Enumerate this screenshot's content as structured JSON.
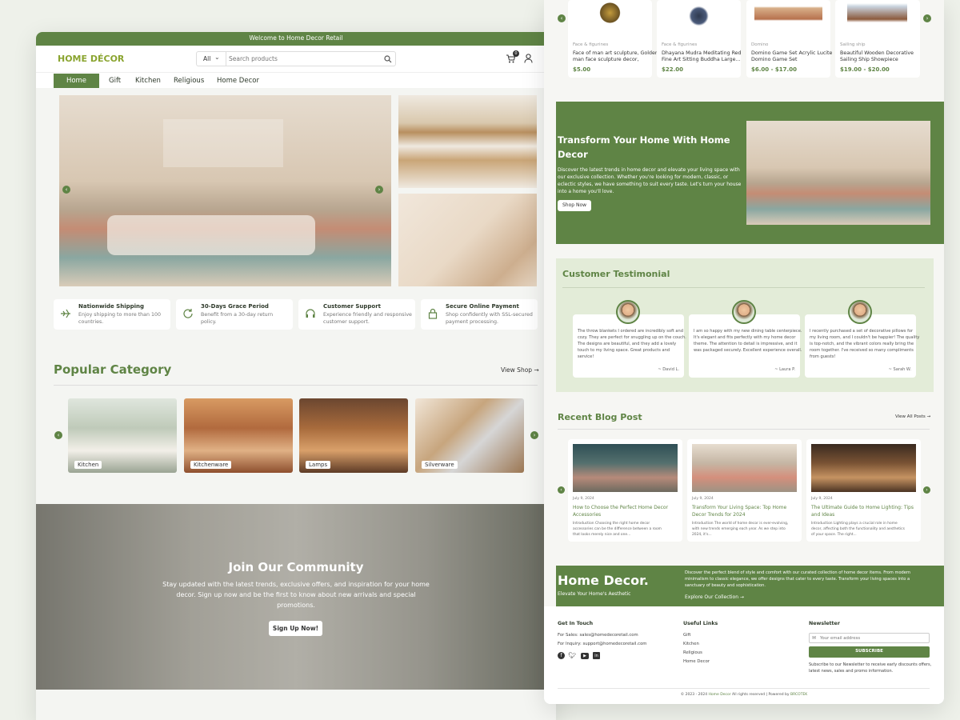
{
  "brand": {
    "logo": "HOME DÉCOR",
    "accent": "#5f8445"
  },
  "topbar": {
    "welcome": "Welcome to Home Decor Retail"
  },
  "header": {
    "search_scope": "All",
    "search_placeholder": "Search products",
    "cart_count": "0"
  },
  "nav": {
    "items": [
      "Home",
      "Gift",
      "Kitchen",
      "Religious",
      "Home Decor"
    ]
  },
  "features": [
    {
      "title": "Nationwide Shipping",
      "desc_1": "Enjoy shipping to more than 100",
      "desc_2": "countries."
    },
    {
      "title": "30-Days Grace Period",
      "desc_1": "Benefit from a 30-day return",
      "desc_2": "policy."
    },
    {
      "title": "Customer Support",
      "desc_1": "Experience friendly and responsive",
      "desc_2": "customer support."
    },
    {
      "title": "Secure Online Payment",
      "desc_1": "Shop confidently with SSL-secured",
      "desc_2": "payment processing."
    }
  ],
  "popular": {
    "title": "Popular Category",
    "link": "View Shop →",
    "items": [
      "Kitchen",
      "Kitchenware",
      "Lamps",
      "Silverware"
    ]
  },
  "community": {
    "title": "Join Our Community",
    "text_1": "Stay updated with the latest trends, exclusive offers, and inspiration for your home",
    "text_2": "decor. Sign up now and be the first to know about new arrivals and special",
    "text_3": "promotions.",
    "button": "Sign Up Now!"
  },
  "products": [
    {
      "category": "Face & figurines",
      "name_1": "Face of man art sculpture, Golden",
      "name_2": "man face sculpture decor,",
      "price": "$5.00"
    },
    {
      "category": "Face & figurines",
      "name_1": "Dhayana Mudra Meditating Red",
      "name_2": "Fine Art Sitting Buddha Large...",
      "price": "$22.00"
    },
    {
      "category": "Domino",
      "name_1": "Domino Game Set Acrylic Lucite",
      "name_2": "Domino Game Set",
      "price": "$6.00 - $17.00"
    },
    {
      "category": "Sailing ship",
      "name_1": "Beautiful Wooden Decorative",
      "name_2": "Sailing Ship Showpiece",
      "price": "$19.00 - $20.00"
    }
  ],
  "transform": {
    "title_1": "Transform Your Home With Home",
    "title_2": "Decor",
    "text_1": "Discover the latest trends in home decor and elevate your living space with",
    "text_2": "our exclusive collection. Whether you're looking for modern, classic, or",
    "text_3": "eclectic styles, we have something to suit every taste. Let's turn your house",
    "text_4": "into a home you'll love.",
    "button": "Shop Now"
  },
  "testimonials": {
    "title": "Customer Testimonial",
    "items": [
      {
        "l1": "The throw blankets I ordered are incredibly soft and",
        "l2": "cozy. They are perfect for snuggling up on the couch.",
        "l3": "The designs are beautiful, and they add a lovely",
        "l4": "touch to my living space. Great products and",
        "l5": "service!",
        "author": "~ David L."
      },
      {
        "l1": "I am so happy with my new dining table centerpiece.",
        "l2": "It's elegant and fits perfectly with my home decor",
        "l3": "theme. The attention to detail is impressive, and it",
        "l4": "was packaged securely. Excellent experience overall.",
        "l5": "",
        "author": "~ Laura P."
      },
      {
        "l1": "I recently purchased a set of decorative pillows for",
        "l2": "my living room, and I couldn't be happier! The quality",
        "l3": "is top-notch, and the vibrant colors really bring the",
        "l4": "room together. I've received so many compliments",
        "l5": "from guests!",
        "author": "~ Sarah W."
      }
    ]
  },
  "blog": {
    "title": "Recent Blog Post",
    "link": "View All Posts →",
    "items": [
      {
        "date": "July 9, 2024",
        "t1": "How to Choose the Perfect Home Decor",
        "t2": "Accessories",
        "e1": "Introduction Choosing the right home decor",
        "e2": "accessories can be the difference between a room",
        "e3": "that looks merely nice and one..."
      },
      {
        "date": "July 9, 2024",
        "t1": "Transform Your Living Space: Top Home",
        "t2": "Decor Trends for 2024",
        "e1": "Introduction The world of home decor is ever-evolving,",
        "e2": "with new trends emerging each year. As we step into",
        "e3": "2024, it's..."
      },
      {
        "date": "July 9, 2024",
        "t1": "The Ultimate Guide to Home Lighting: Tips",
        "t2": "and Ideas",
        "e1": "Introduction Lighting plays a crucial role in home",
        "e2": "decor, affecting both the functionality and aesthetics",
        "e3": "of your space. The right..."
      }
    ]
  },
  "footer": {
    "brand": "Home Decor.",
    "tagline": "Elevate Your Home's Aesthetic",
    "about_1": "Discover the perfect blend of style and comfort with our curated collection of home decor items. From modern",
    "about_2": "minimalism to classic elegance, we offer designs that cater to every taste. Transform your living spaces into a",
    "about_3": "sanctuary of beauty and sophistication.",
    "explore": "Explore Our Collection →",
    "contact_title": "Get In Touch",
    "sales": "For Sales: sales@homedecoretail.com",
    "inquiry": "For Inquiry: support@homedecoretail.com",
    "links_title": "Useful Links",
    "links": [
      "Gift",
      "Kitchen",
      "Religious",
      "Home Decor"
    ],
    "newsletter_title": "Newsletter",
    "email_placeholder": "Your email address",
    "subscribe": "SUBSCRIBE",
    "newsletter_1": "Subscribe to our Newsletter to receive early discounts offers,",
    "newsletter_2": "latest news, sales and promo information.",
    "copyright_pre": "© 2023 - 2024",
    "copyright_brand": "Home Decor",
    "copyright_mid": "All rights reserved | Powered by",
    "copyright_power": "BRCOTEK"
  },
  "icons": [
    "cart-icon",
    "user-icon",
    "search-icon",
    "chevron-down-icon",
    "plane-icon",
    "refresh-icon",
    "headset-icon",
    "lock-icon",
    "chevron-left-icon",
    "chevron-right-icon",
    "facebook-icon",
    "twitter-icon",
    "youtube-icon",
    "linkedin-icon",
    "mail-icon"
  ]
}
